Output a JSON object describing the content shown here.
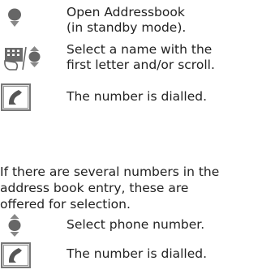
{
  "steps": [
    {
      "icon": "navigation-key-down-icon",
      "lines": [
        "Open Addressbook",
        "(in standby mode)."
      ]
    },
    {
      "icon": "keypad-or-navigation-key-icon",
      "lines": [
        "Select a name with the",
        "first letter and/or scroll."
      ]
    },
    {
      "icon": "call-key-icon",
      "lines": [
        "The number is dialled."
      ]
    }
  ],
  "note_lines": [
    "If there are several numbers in the",
    "address book entry, these are",
    "offered for selection."
  ],
  "steps_after": [
    {
      "icon": "navigation-key-up-down-icon",
      "lines": [
        "Select phone number."
      ]
    },
    {
      "icon": "call-key-icon",
      "lines": [
        "The number is dialled."
      ]
    }
  ],
  "colors": {
    "text": "#222222",
    "icon_gray": "#6b6b6b",
    "icon_light": "#d9d9d9"
  }
}
